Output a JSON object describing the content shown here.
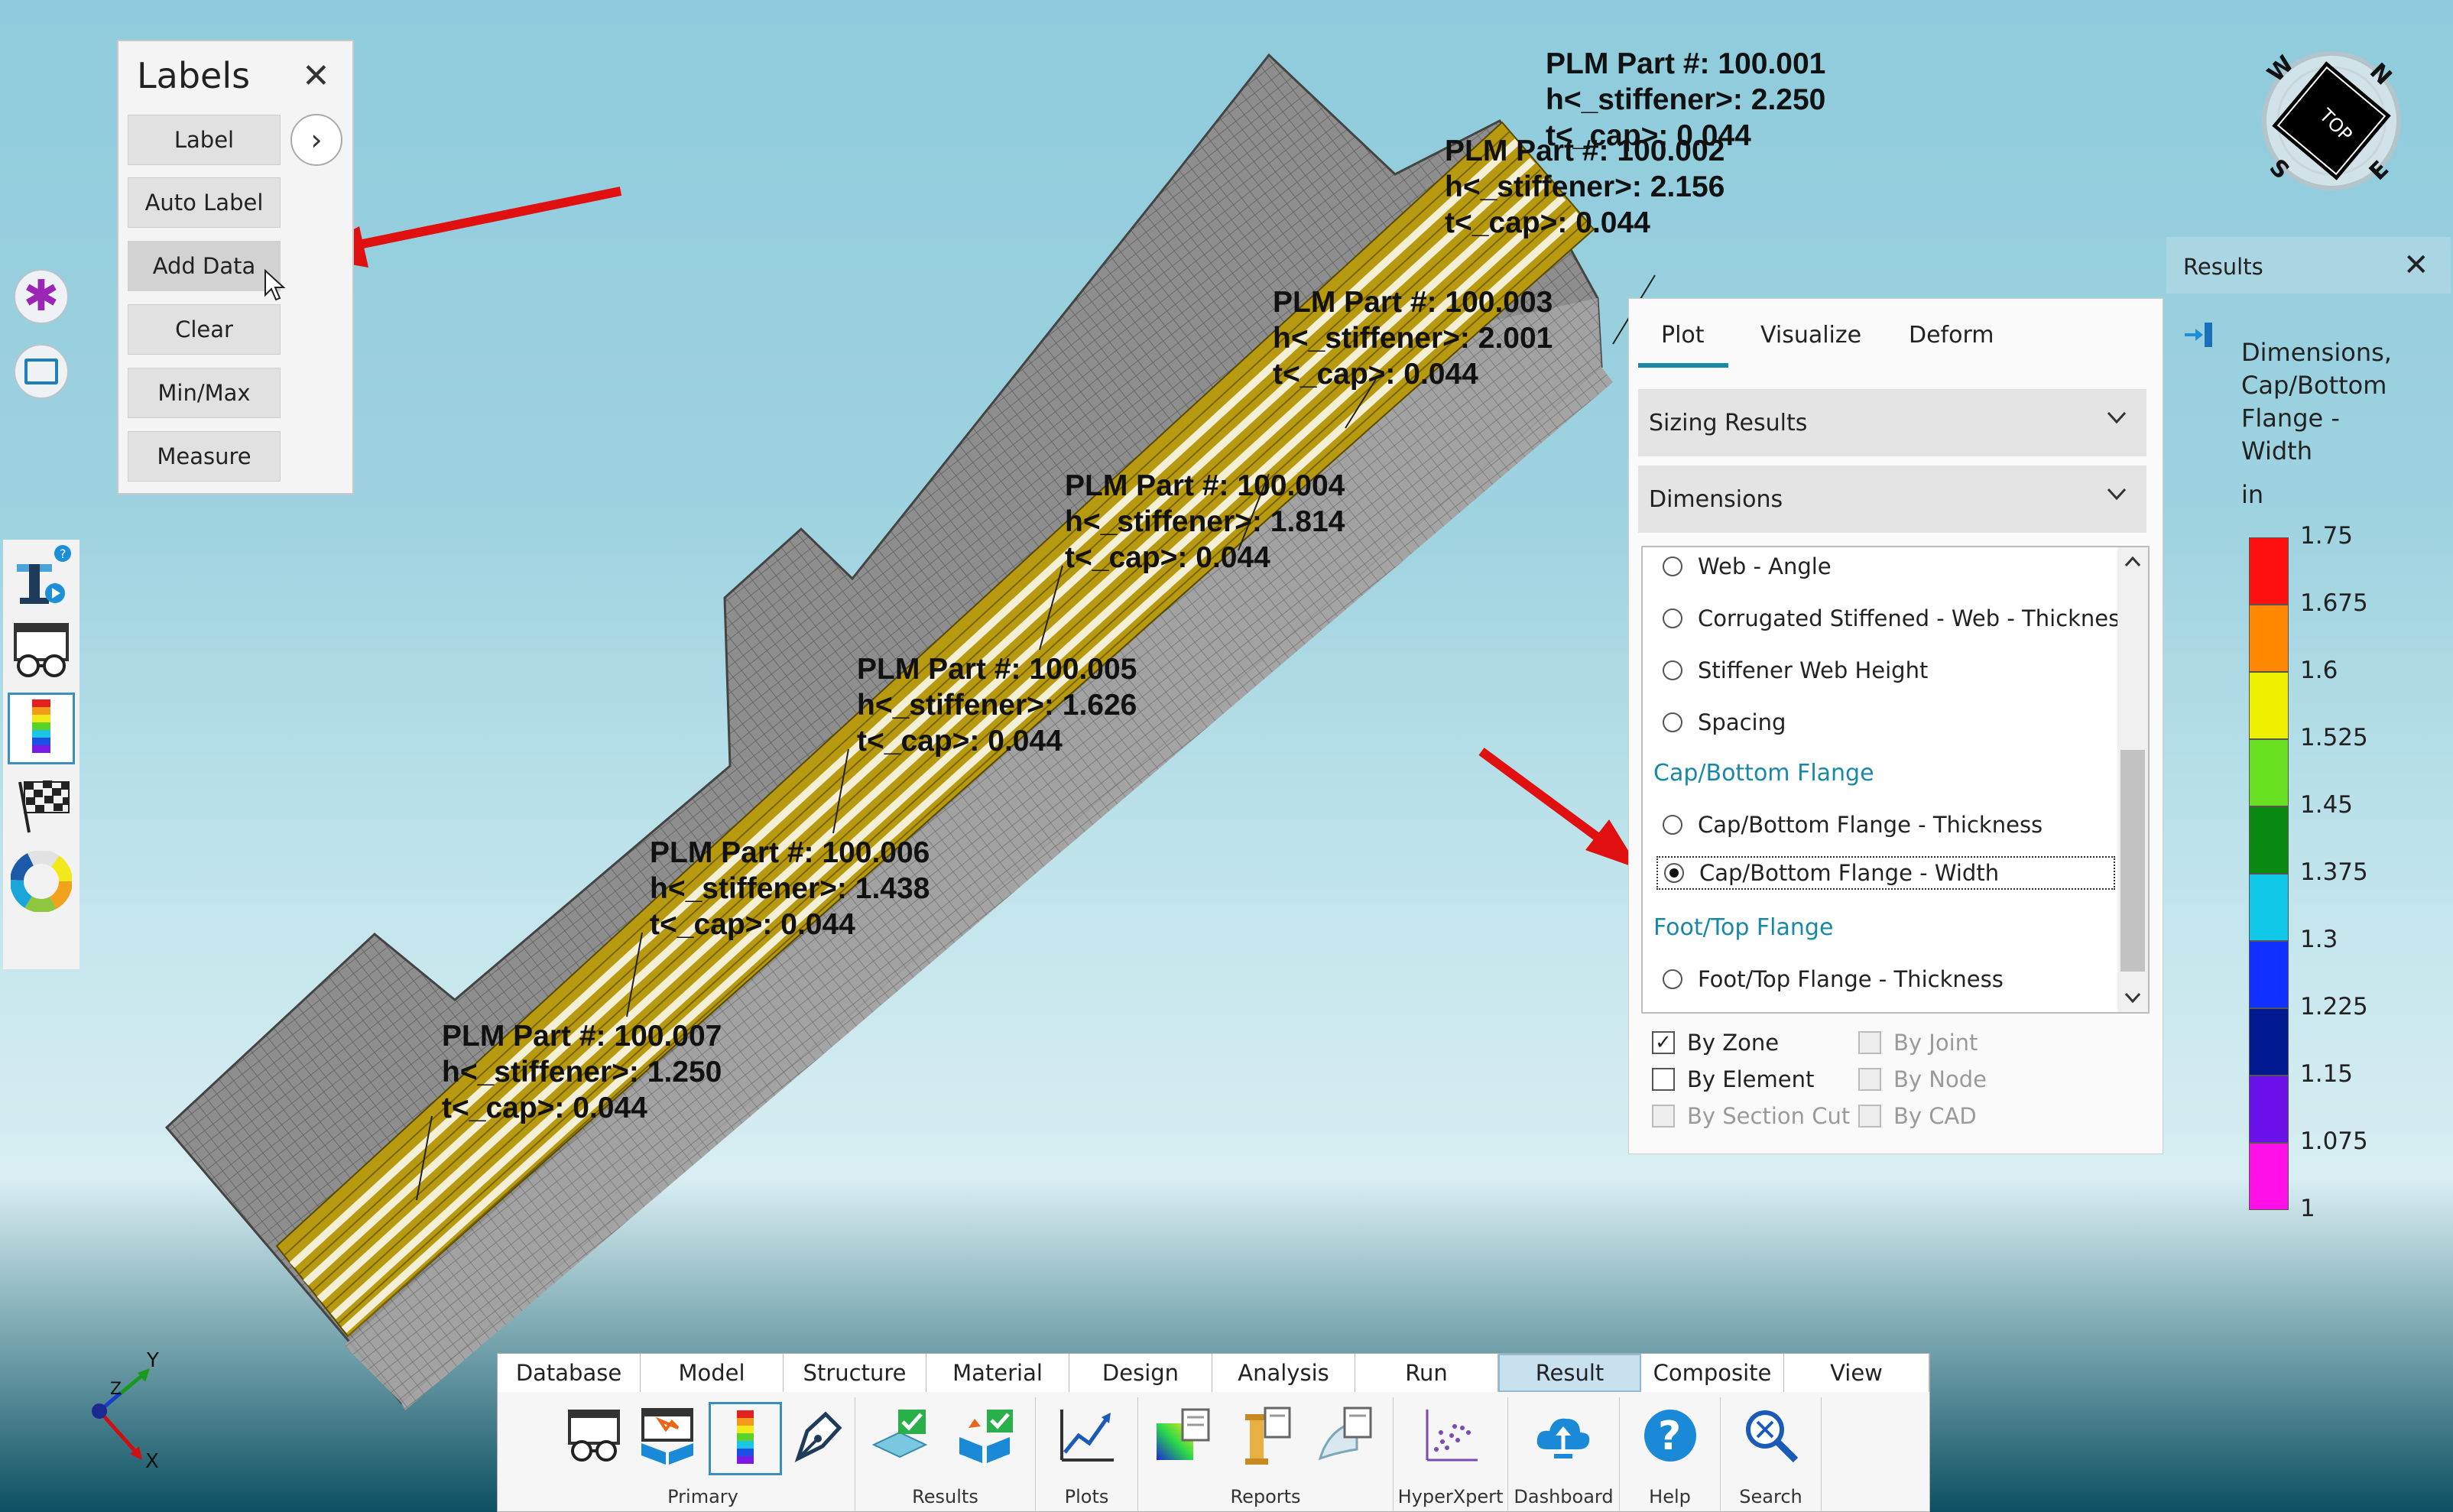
{
  "labels_panel": {
    "title": "Labels",
    "buttons": [
      "Label",
      "Auto Label",
      "Add Data",
      "Clear",
      "Min/Max",
      "Measure"
    ]
  },
  "model_labels": [
    {
      "lines": [
        "PLM Part #: 100.001",
        "h<_stiffener>: 2.250",
        "t<_cap>: 0.044"
      ]
    },
    {
      "lines": [
        "PLM Part #: 100.002",
        "h<_stiffener>: 2.156",
        "t<_cap>: 0.044"
      ]
    },
    {
      "lines": [
        "PLM Part #: 100.003",
        "h<_stiffener>: 2.001",
        "t<_cap>: 0.044"
      ]
    },
    {
      "lines": [
        "PLM Part #: 100.004",
        "h<_stiffener>: 1.814",
        "t<_cap>: 0.044"
      ]
    },
    {
      "lines": [
        "PLM Part #: 100.005",
        "h<_stiffener>: 1.626",
        "t<_cap>: 0.044"
      ]
    },
    {
      "lines": [
        "PLM Part #: 100.006",
        "h<_stiffener>: 1.438",
        "t<_cap>: 0.044"
      ]
    },
    {
      "lines": [
        "PLM Part #: 100.007",
        "h<_stiffener>: 1.250",
        "t<_cap>: 0.044"
      ]
    }
  ],
  "compass": {
    "top_label": "TOP",
    "n": "N",
    "e": "E",
    "s": "S",
    "w": "W"
  },
  "plot_panel": {
    "tabs": [
      "Plot",
      "Visualize",
      "Deform"
    ],
    "active_tab": "Plot",
    "dropdown1": "Sizing Results",
    "dropdown2": "Dimensions",
    "list": {
      "item_web_angle": "Web - Angle",
      "item_corr_web": "Corrugated Stiffened - Web - Thickness",
      "item_stiff_height": "Stiffener Web Height",
      "item_spacing": "Spacing",
      "group_cap": "Cap/Bottom Flange",
      "item_cap_thick": "Cap/Bottom Flange - Thickness",
      "item_cap_width": "Cap/Bottom Flange - Width",
      "group_foot": "Foot/Top Flange",
      "item_foot_thick": "Foot/Top Flange - Thickness"
    },
    "checks": {
      "by_zone": "By Zone",
      "by_element": "By Element",
      "by_section_cut": "By Section Cut",
      "by_joint": "By Joint",
      "by_node": "By Node",
      "by_cad": "By CAD"
    }
  },
  "results_panel": {
    "title": "Results",
    "desc1": "Dimensions,",
    "desc2": "Cap/Bottom",
    "desc3": "Flange -",
    "desc4": "Width",
    "unit": "in",
    "legend": [
      {
        "value": "1.75",
        "color": "#ff1010"
      },
      {
        "value": "1.675",
        "color": "#ff8800"
      },
      {
        "value": "1.6",
        "color": "#eef000"
      },
      {
        "value": "1.525",
        "color": "#66e020"
      },
      {
        "value": "1.45",
        "color": "#0a8a10"
      },
      {
        "value": "1.375",
        "color": "#10c8e8"
      },
      {
        "value": "1.3",
        "color": "#1030ff"
      },
      {
        "value": "1.225",
        "color": "#001890"
      },
      {
        "value": "1.15",
        "color": "#6a10e8"
      },
      {
        "value": "1.075",
        "color": "#ff10e8"
      },
      {
        "value": "1",
        "color": ""
      }
    ]
  },
  "axes": {
    "x": "X",
    "y": "Y",
    "z": "Z"
  },
  "ribbon": {
    "tabs": [
      "Database",
      "Model",
      "Structure",
      "Material",
      "Design",
      "Analysis",
      "Run",
      "Result",
      "Composite",
      "View"
    ],
    "active_tab": "Result",
    "groups": {
      "primary": "Primary",
      "results": "Results",
      "plots": "Plots",
      "reports": "Reports",
      "hyperxpert": "HyperXpert",
      "dashboard": "Dashboard",
      "help": "Help",
      "search": "Search"
    }
  },
  "colors": {
    "accent": "#1888a8",
    "annotation_arrow": "#e01010",
    "stiffener": "#b89a10"
  }
}
